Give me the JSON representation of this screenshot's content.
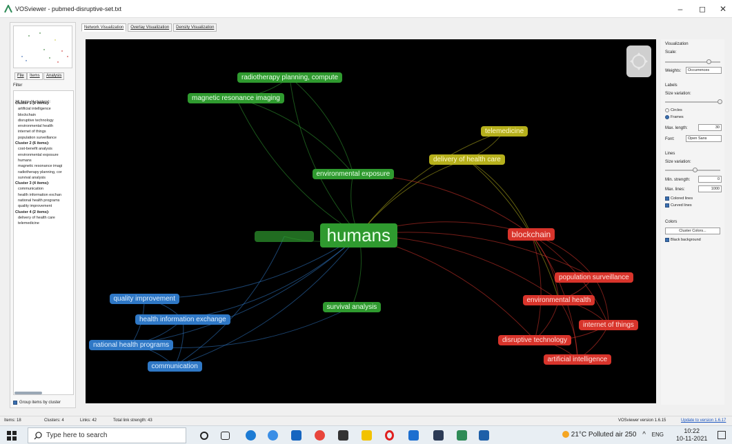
{
  "window": {
    "title": "VOSviewer - pubmed-disruptive-set.txt",
    "minimize": "–",
    "maximize": "◻",
    "close": "✕"
  },
  "left_tabs": [
    "File",
    "Items",
    "Analysis"
  ],
  "filter_label": "Filter",
  "items_summary": "18 items (4 clusters):",
  "clusters": [
    {
      "header": "Cluster 1 (6 items):",
      "items": [
        "artificial intelligence",
        "blockchain",
        "disruptive technology",
        "environmental health",
        "internet of things",
        "population surveillance"
      ]
    },
    {
      "header": "Cluster 2 (6 items):",
      "items": [
        "cost-benefit analysis",
        "environmental exposure",
        "humans",
        "magnetic resonance imagi",
        "radiotherapy planning, cor",
        "survival analysis"
      ]
    },
    {
      "header": "Cluster 3 (4 items):",
      "items": [
        "communication",
        "health information exchan",
        "national health programs",
        "quality improvement"
      ]
    },
    {
      "header": "Cluster 4 (2 items):",
      "items": [
        "delivery of health care",
        "telemedicine"
      ]
    }
  ],
  "group_by_cluster": "Group items by cluster",
  "viz_tabs": [
    "Network Visualization",
    "Overlay Visualization",
    "Density Visualization"
  ],
  "colors": {
    "green": "#2f9a2f",
    "red": "#d8342b",
    "blue": "#2f78c6",
    "yellow": "#b6b01c",
    "canvas": "#000000"
  },
  "network_nodes": [
    {
      "label": "radiotherapy planning, compute",
      "cluster": 2
    },
    {
      "label": "magnetic resonance imaging",
      "cluster": 2
    },
    {
      "label": "environmental exposure",
      "cluster": 2
    },
    {
      "label": "humans",
      "cluster": 2
    },
    {
      "label": "survival analysis",
      "cluster": 2
    },
    {
      "label": "",
      "cluster": 2
    },
    {
      "label": "telemedicine",
      "cluster": 4
    },
    {
      "label": "delivery of health care",
      "cluster": 4
    },
    {
      "label": "blockchain",
      "cluster": 1
    },
    {
      "label": "population surveillance",
      "cluster": 1
    },
    {
      "label": "environmental health",
      "cluster": 1
    },
    {
      "label": "internet of things",
      "cluster": 1
    },
    {
      "label": "disruptive technology",
      "cluster": 1
    },
    {
      "label": "artificial intelligence",
      "cluster": 1
    },
    {
      "label": "quality improvement",
      "cluster": 3
    },
    {
      "label": "health information exchange",
      "cluster": 3
    },
    {
      "label": "national health programs",
      "cluster": 3
    },
    {
      "label": "communication",
      "cluster": 3
    }
  ],
  "right_panel": {
    "visualization": "Visualization",
    "scale": "Scale:",
    "weights_label": "Weights:",
    "weights_value": "Occurrences",
    "labels": "Labels",
    "size_variation": "Size variation:",
    "circles": "Circles",
    "frames": "Frames",
    "max_length_label": "Max. length:",
    "max_length_value": "30",
    "font_label": "Font:",
    "font_value": "Open Sans",
    "lines": "Lines",
    "lines_size_variation": "Size variation:",
    "min_strength_label": "Min. strength:",
    "min_strength_value": "0",
    "max_lines_label": "Max. lines:",
    "max_lines_value": "1000",
    "colored_lines": "Colored lines",
    "curved_lines": "Curved lines",
    "colors": "Colors",
    "colors_value": "Cluster Colors...",
    "black_background": "Black background"
  },
  "status": {
    "items": "Items: 18",
    "clusters": "Clusters: 4",
    "links": "Links: 42",
    "strength": "Total link strength: 43",
    "version": "VOSviewer version 1.6.15",
    "update": "Update to version 1.6.17"
  },
  "taskbar": {
    "search_placeholder": "Type here to search",
    "weather": "21°C  Polluted air 250",
    "lang": "ENG",
    "time": "10:22",
    "date": "10-11-2021"
  }
}
